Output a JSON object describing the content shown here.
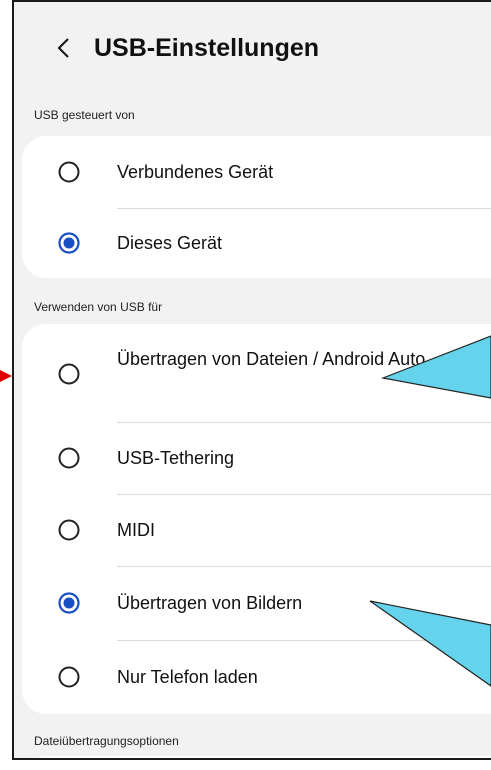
{
  "header": {
    "title": "USB-Einstellungen",
    "back_icon": "chevron-left-icon"
  },
  "sections": [
    {
      "label": "USB gesteuert von",
      "options": [
        {
          "label": "Verbundenes Gerät",
          "selected": false
        },
        {
          "label": "Dieses Gerät",
          "selected": true
        }
      ]
    },
    {
      "label": "Verwenden von USB für",
      "options": [
        {
          "label": "Übertragen von Dateien / Android Auto",
          "selected": false
        },
        {
          "label": "USB-Tethering",
          "selected": false
        },
        {
          "label": "MIDI",
          "selected": false
        },
        {
          "label": "Übertragen von Bildern",
          "selected": true
        },
        {
          "label": "Nur Telefon laden",
          "selected": false
        }
      ]
    },
    {
      "label": "Dateiübertragungsoptionen",
      "options": []
    }
  ],
  "colors": {
    "accent": "#1a4fc4",
    "callout": "#66d3ec",
    "arrow": "#e00000"
  }
}
